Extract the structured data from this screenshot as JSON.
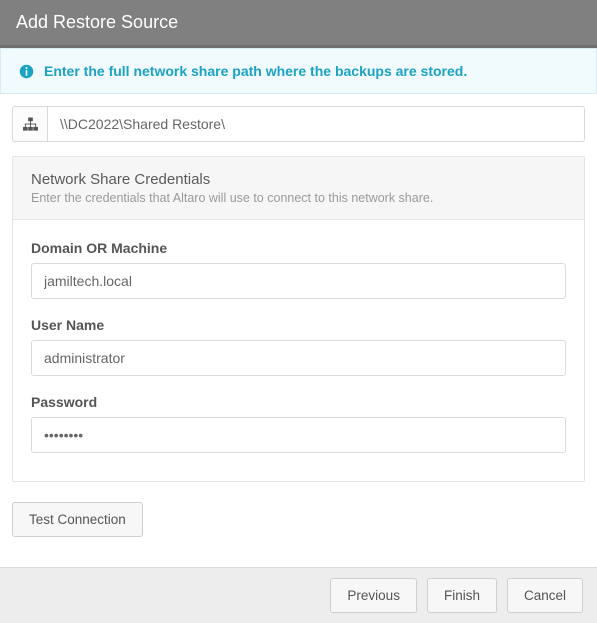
{
  "title": "Add Restore Source",
  "info": {
    "message": "Enter the full network share path where the backups are stored."
  },
  "path": {
    "value": "\\\\DC2022\\Shared Restore\\"
  },
  "credentials": {
    "heading": "Network Share Credentials",
    "subheading": "Enter the credentials that Altaro will use to connect to this network share.",
    "domain_label": "Domain OR Machine",
    "domain_value": "jamiltech.local",
    "username_label": "User Name",
    "username_value": "administrator",
    "password_label": "Password",
    "password_value": "xxxxxxxx"
  },
  "buttons": {
    "test": "Test Connection",
    "previous": "Previous",
    "finish": "Finish",
    "cancel": "Cancel"
  }
}
